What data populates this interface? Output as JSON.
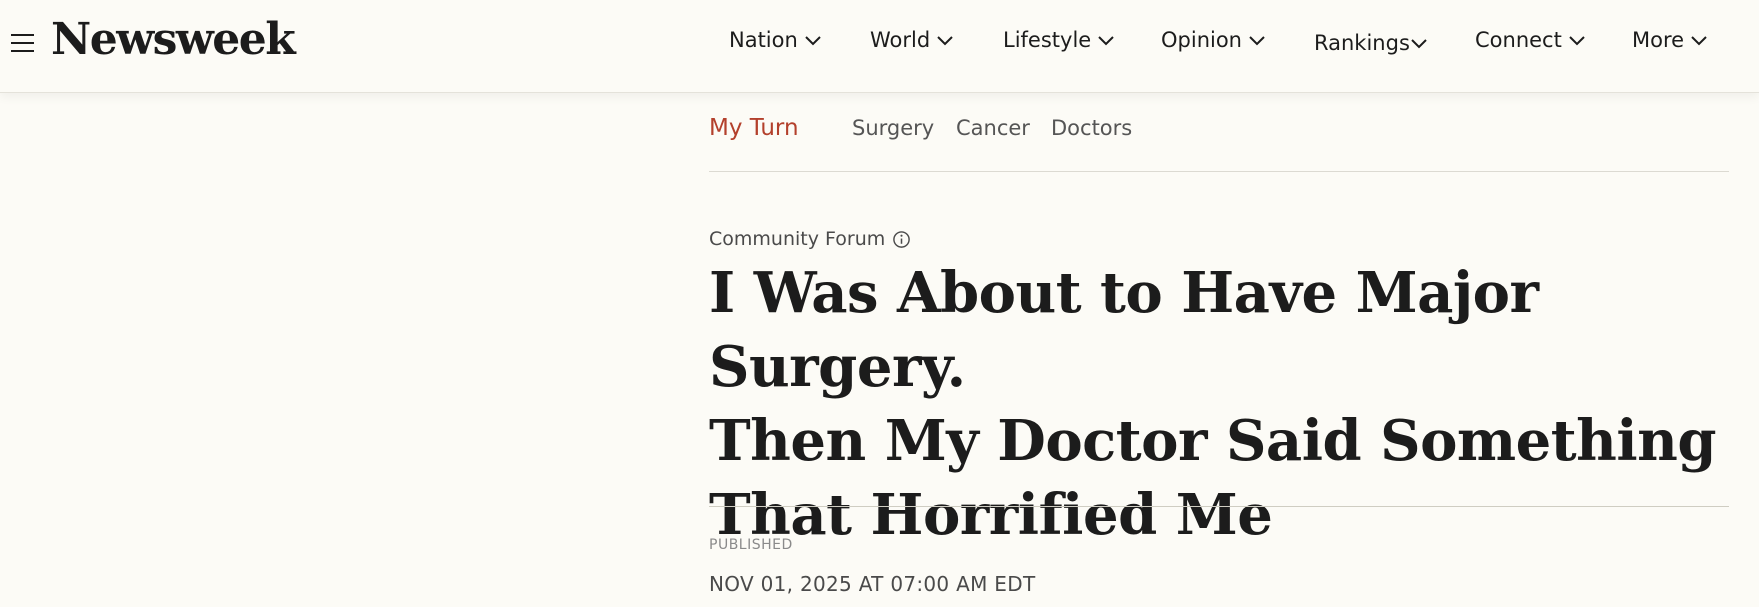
{
  "header": {
    "logo": "Newsweek",
    "nav": [
      {
        "label": "Nation"
      },
      {
        "label": "World"
      },
      {
        "label": "Lifestyle"
      },
      {
        "label": "Opinion"
      },
      {
        "label": "Rankings"
      },
      {
        "label": "Connect"
      },
      {
        "label": "More"
      }
    ]
  },
  "subnav": {
    "section": "My Turn",
    "topics": [
      "Surgery",
      "Cancer",
      "Doctors"
    ]
  },
  "article": {
    "kicker": "Community Forum",
    "headline_lines": [
      "I Was About to Have Major Surgery.",
      "Then My Doctor Said Something",
      "That Horrified Me"
    ],
    "published_label": "PUBLISHED",
    "published_date": "NOV 01, 2025 AT 07:00 AM EDT"
  },
  "colors": {
    "background": "#fcfbf6",
    "accent": "#b3402c",
    "text": "#1c1c1c"
  },
  "icons": [
    "menu-icon",
    "chevron-down-icon",
    "info-icon"
  ]
}
